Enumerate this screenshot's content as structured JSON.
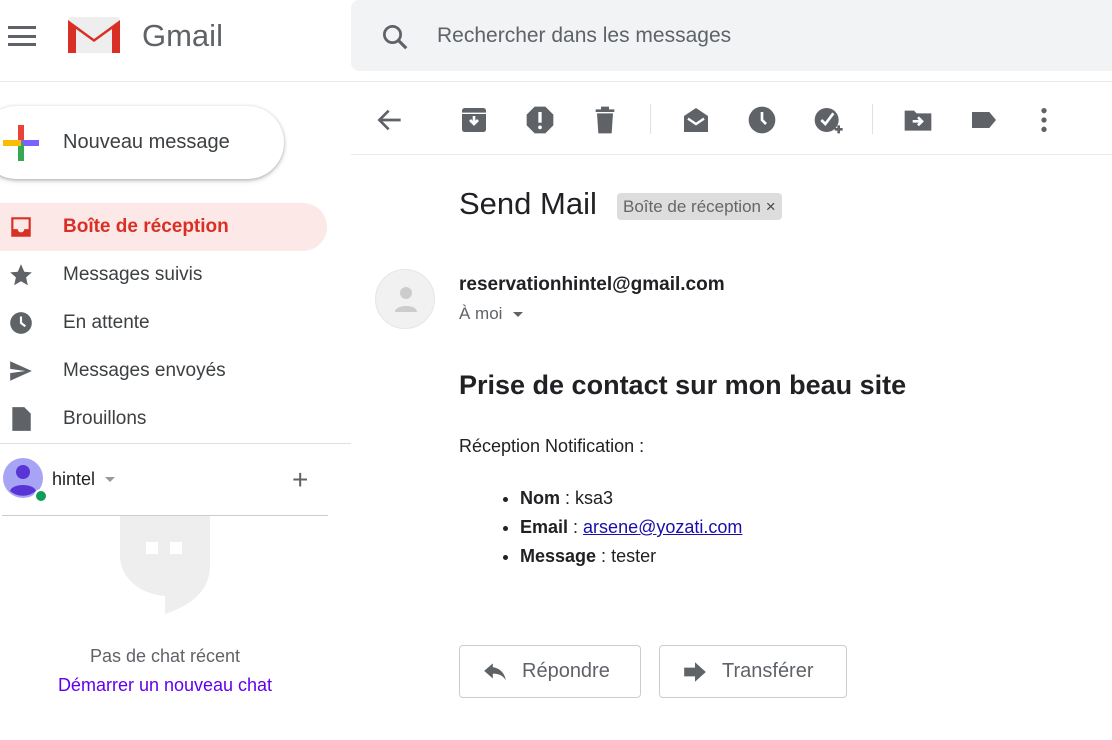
{
  "app": {
    "brand": "Gmail"
  },
  "search": {
    "placeholder": "Rechercher dans les messages"
  },
  "compose": {
    "label": "Nouveau message"
  },
  "nav": [
    {
      "label": "Boîte de réception",
      "icon": "inbox-icon",
      "active": true
    },
    {
      "label": "Messages suivis",
      "icon": "star-icon"
    },
    {
      "label": "En attente",
      "icon": "clock-icon"
    },
    {
      "label": "Messages envoyés",
      "icon": "send-icon"
    },
    {
      "label": "Brouillons",
      "icon": "draft-icon"
    }
  ],
  "hangouts": {
    "user": "hintel",
    "empty": "Pas de chat récent",
    "start": "Démarrer un nouveau chat"
  },
  "email": {
    "subject": "Send Mail",
    "label": "Boîte de réception",
    "label_close": "×",
    "sender": "reservationhintel@gmail.com",
    "to": "À moi",
    "heading": "Prise de contact sur mon beau site",
    "intro": "Réception Notification :",
    "fields": [
      {
        "name": "Nom",
        "sep": " : ",
        "value": "ksa3"
      },
      {
        "name": "Email",
        "sep": " : ",
        "value": "arsene@yozati.com",
        "link": true
      },
      {
        "name": "Message",
        "sep": " : ",
        "value": "tester"
      }
    ]
  },
  "actions": {
    "reply": "Répondre",
    "forward": "Transférer"
  },
  "colors": {
    "accent": "#d93025",
    "active_bg": "#fce8e6",
    "link": "#1a0dab",
    "chat_link": "#6200ee"
  }
}
